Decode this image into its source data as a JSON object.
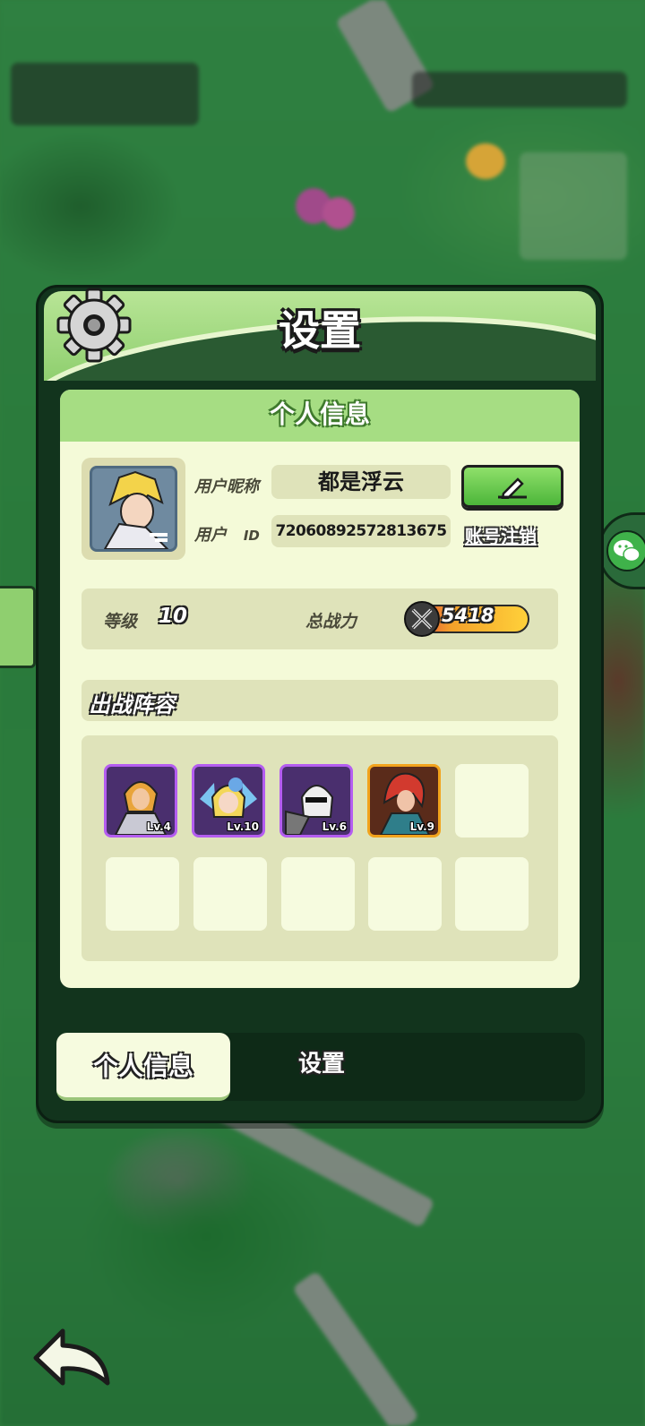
{
  "panel": {
    "title": "设置",
    "section_title": "个人信息"
  },
  "profile": {
    "nickname_label": "用户昵称",
    "nickname_value": "都是浮云",
    "id_label_1": "用户",
    "id_label_2": "ID",
    "id_value": "7206089257281367​5",
    "cancel_account": "账号注销"
  },
  "stats": {
    "level_label": "等级",
    "level_value": "10",
    "power_label": "总战力",
    "power_value": "5418"
  },
  "team": {
    "title": "出战阵容",
    "heroes": [
      {
        "level": "Lv.4",
        "frame": "#b45df0"
      },
      {
        "level": "Lv.10",
        "frame": "#b45df0"
      },
      {
        "level": "Lv.6",
        "frame": "#b45df0"
      },
      {
        "level": "Lv.9",
        "frame": "#f2a31c"
      }
    ]
  },
  "tabs": {
    "tab1": "个人信息",
    "tab2": "设置"
  },
  "icons": {
    "gear": "gear-icon",
    "edit": "pencil-icon",
    "power": "crossed-swords-icon",
    "back": "back-arrow-icon",
    "wechat": "wechat-icon"
  }
}
